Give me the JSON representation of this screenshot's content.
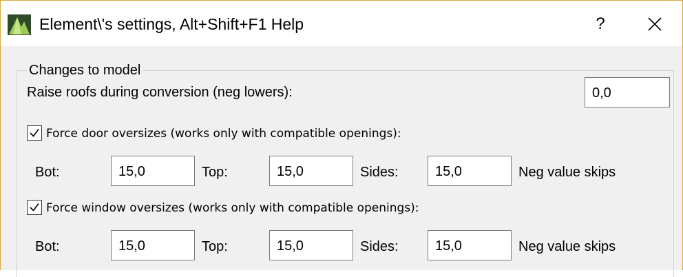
{
  "window": {
    "title": "Element\\'s settings, Alt+Shift+F1 Help",
    "help_label": "?",
    "icons": {
      "app": "app-logo-icon",
      "close": "close-icon"
    }
  },
  "group": {
    "legend": "Changes to model",
    "raise_roofs": {
      "label": "Raise roofs during conversion (neg lowers):",
      "value": "0,0"
    },
    "door": {
      "checked": true,
      "label": "Force door oversizes (works only with compatible openings):",
      "bot_label": "Bot:",
      "bot_value": "15,0",
      "top_label": "Top:",
      "top_value": "15,0",
      "sides_label": "Sides:",
      "sides_value": "15,0",
      "note": "Neg value skips"
    },
    "window_oversize": {
      "checked": true,
      "label": "Force window oversizes (works only with compatible openings):",
      "bot_label": "Bot:",
      "bot_value": "15,0",
      "top_label": "Top:",
      "top_value": "15,0",
      "sides_label": "Sides:",
      "sides_value": "15,0",
      "note": "Neg value skips"
    }
  }
}
